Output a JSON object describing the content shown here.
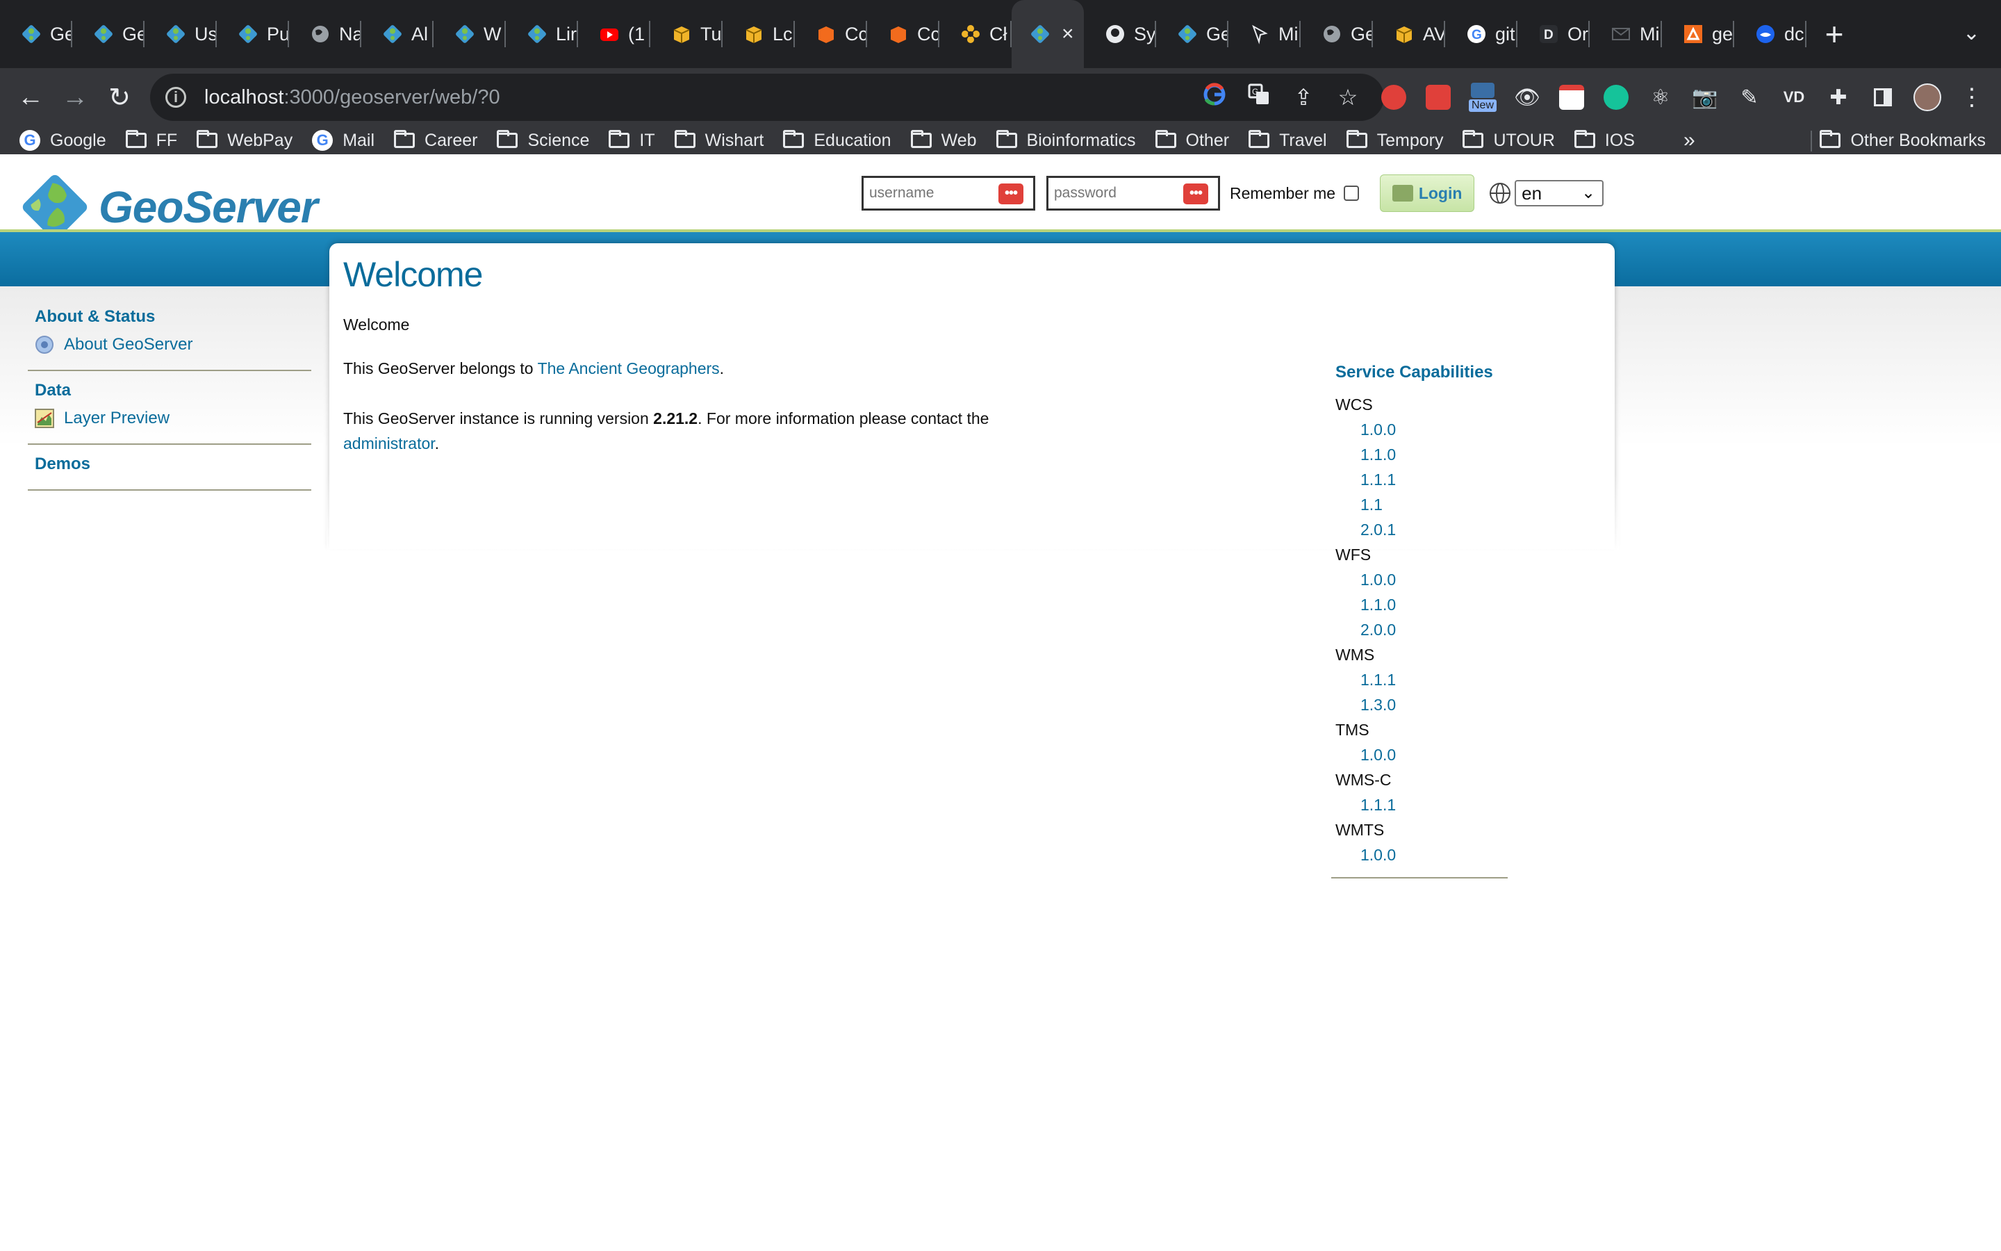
{
  "browser": {
    "tabs": [
      {
        "title": "Ge",
        "icon": "geoserver-icon"
      },
      {
        "title": "Ge",
        "icon": "geoserver-icon"
      },
      {
        "title": "Us",
        "icon": "geoserver-icon"
      },
      {
        "title": "Pu",
        "icon": "geoserver-icon"
      },
      {
        "title": "Na",
        "icon": "globe-icon"
      },
      {
        "title": "Al",
        "icon": "geoserver-icon"
      },
      {
        "title": "W",
        "icon": "geoserver-icon"
      },
      {
        "title": "Lir",
        "icon": "geoserver-icon"
      },
      {
        "title": "(1",
        "icon": "youtube-icon"
      },
      {
        "title": "Tu",
        "icon": "box-icon"
      },
      {
        "title": "Lc",
        "icon": "box-icon"
      },
      {
        "title": "Cc",
        "icon": "orange-cube-icon"
      },
      {
        "title": "Cc",
        "icon": "orange-cube-icon"
      },
      {
        "title": "Cł",
        "icon": "flower-icon"
      },
      {
        "title": "",
        "icon": "geoserver-icon",
        "active": true
      },
      {
        "title": "Sy",
        "icon": "github-icon"
      },
      {
        "title": "Ge",
        "icon": "geoserver-icon"
      },
      {
        "title": "Mi",
        "icon": "arrow-icon"
      },
      {
        "title": "Ge",
        "icon": "globe-icon"
      },
      {
        "title": "AV",
        "icon": "box-icon"
      },
      {
        "title": "git",
        "icon": "google-icon"
      },
      {
        "title": "Or",
        "icon": "d-icon"
      },
      {
        "title": "Mi",
        "icon": "mail-icon"
      },
      {
        "title": "ge",
        "icon": "orange-grid-icon"
      },
      {
        "title": "dc",
        "icon": "docker-icon"
      }
    ],
    "active_tab_close": "×",
    "new_tab": "+",
    "tab_menu": "⌄",
    "url_host": "localhost",
    "url_rest": ":3000/geoserver/web/?0",
    "bookmarks": [
      {
        "label": "Google",
        "type": "google"
      },
      {
        "label": "FF",
        "type": "folder"
      },
      {
        "label": "WebPay",
        "type": "folder"
      },
      {
        "label": "Mail",
        "type": "google"
      },
      {
        "label": "Career",
        "type": "folder"
      },
      {
        "label": "Science",
        "type": "folder"
      },
      {
        "label": "IT",
        "type": "folder"
      },
      {
        "label": "Wishart",
        "type": "folder"
      },
      {
        "label": "Education",
        "type": "folder"
      },
      {
        "label": "Web",
        "type": "folder"
      },
      {
        "label": "Bioinformatics",
        "type": "folder"
      },
      {
        "label": "Other",
        "type": "folder"
      },
      {
        "label": "Travel",
        "type": "folder"
      },
      {
        "label": "Tempory",
        "type": "folder"
      },
      {
        "label": "UTOUR",
        "type": "folder"
      },
      {
        "label": "IOS",
        "type": "folder"
      }
    ],
    "bookmarks_overflow": "»",
    "other_bookmarks": "Other Bookmarks",
    "extension_new_badge": "New"
  },
  "header": {
    "logo_text": "GeoServer",
    "username_placeholder": "username",
    "password_placeholder": "password",
    "remember_me": "Remember me",
    "login_label": "Login",
    "language": "en"
  },
  "sidebar": {
    "sections": [
      {
        "title": "About & Status",
        "items": [
          {
            "label": "About GeoServer",
            "icon": "info-icon"
          }
        ]
      },
      {
        "title": "Data",
        "items": [
          {
            "label": "Layer Preview",
            "icon": "map-preview-icon"
          }
        ]
      },
      {
        "title": "Demos",
        "items": []
      }
    ]
  },
  "main": {
    "title": "Welcome",
    "subtitle": "Welcome",
    "belongs_prefix": "This GeoServer belongs to ",
    "belongs_link": "The Ancient Geographers",
    "belongs_suffix": ".",
    "version_prefix": "This GeoServer instance is running version ",
    "version": "2.21.2",
    "version_suffix": ". For more information please contact the",
    "admin_link": "administrator",
    "admin_suffix": "."
  },
  "capabilities": {
    "title": "Service Capabilities",
    "services": [
      {
        "name": "WCS",
        "versions": [
          "1.0.0",
          "1.1.0",
          "1.1.1",
          "1.1",
          "2.0.1"
        ]
      },
      {
        "name": "WFS",
        "versions": [
          "1.0.0",
          "1.1.0",
          "2.0.0"
        ]
      },
      {
        "name": "WMS",
        "versions": [
          "1.1.1",
          "1.3.0"
        ]
      },
      {
        "name": "TMS",
        "versions": [
          "1.0.0"
        ]
      },
      {
        "name": "WMS-C",
        "versions": [
          "1.1.1"
        ]
      },
      {
        "name": "WMTS",
        "versions": [
          "1.0.0"
        ]
      }
    ]
  },
  "colors": {
    "accent": "#0a6c9b",
    "band_blue": "#1e8bbf",
    "login_green": "#c7e4a6",
    "chrome_dark": "#202124"
  }
}
